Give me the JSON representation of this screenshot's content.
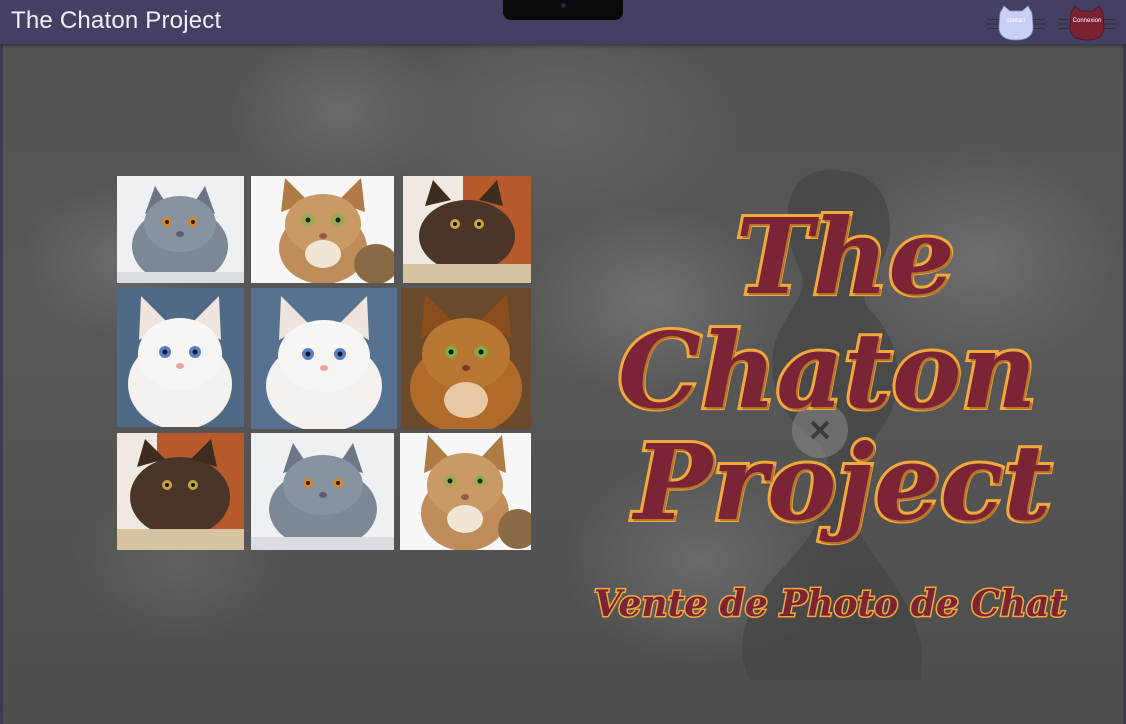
{
  "header": {
    "title": "The Chaton Project",
    "contact_label": "contact",
    "connexion_label": "Connexion"
  },
  "hero": {
    "title_line1": "The",
    "title_line2": "Chaton",
    "title_line3": "Project",
    "subtitle": "Vente de Photo de Chat"
  },
  "gallery": {
    "photos": [
      {
        "name": "grey-british-shorthair-kitten",
        "icon": "cat-photo"
      },
      {
        "name": "bengal-kitten",
        "icon": "cat-photo"
      },
      {
        "name": "chocolate-kitten",
        "icon": "cat-photo"
      },
      {
        "name": "white-blue-eyed-kitten",
        "icon": "cat-photo"
      },
      {
        "name": "white-blue-eyed-kitten-2",
        "icon": "cat-photo"
      },
      {
        "name": "somali-cat",
        "icon": "cat-photo"
      },
      {
        "name": "chocolate-kitten-2",
        "icon": "cat-photo"
      },
      {
        "name": "grey-british-shorthair-kitten-2",
        "icon": "cat-photo"
      },
      {
        "name": "bengal-kitten-2",
        "icon": "cat-photo"
      }
    ]
  },
  "colors": {
    "topbar": "#453f63",
    "title_fill": "#7a2436",
    "title_outline": "#f0a93a",
    "contact_button": "#c9d0f5",
    "connexion_button": "#7a2232"
  }
}
